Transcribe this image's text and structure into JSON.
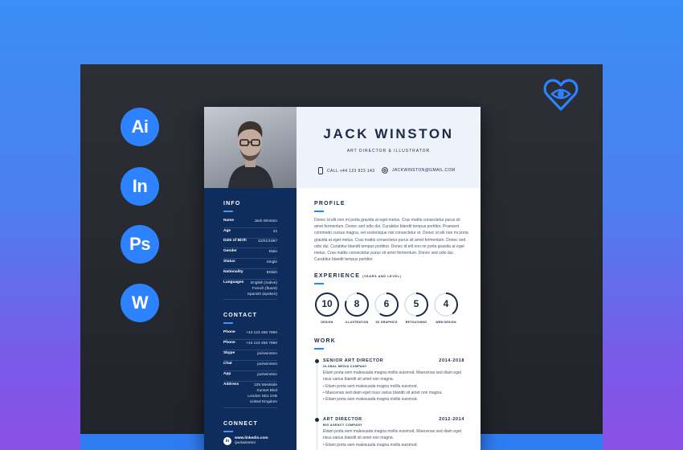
{
  "app_badges": [
    {
      "label": "Ai",
      "icon": "illustrator-icon"
    },
    {
      "label": "In",
      "icon": "indesign-icon"
    },
    {
      "label": "Ps",
      "icon": "photoshop-icon"
    },
    {
      "label": "W",
      "icon": "word-icon"
    }
  ],
  "logo": {
    "icon": "heart-eye-logo-icon",
    "color": "#2d82ff"
  },
  "colors": {
    "accent": "#2d82ff",
    "sidebar": "#0f2d5c",
    "header_bg": "#eef3fb",
    "ink": "#1b2a45"
  },
  "resume": {
    "name": "JACK WINSTON",
    "title": "ART DIRECTOR & ILLUSTRATOR",
    "phone": "CALL +44 123 823 143",
    "email": "JACKWINSTON@GMAIL.COM",
    "info": {
      "heading": "INFO",
      "rows": [
        {
          "key": "Name",
          "value": "Jack Winston"
        },
        {
          "key": "Age",
          "value": "32"
        },
        {
          "key": "Date of Birth",
          "value": "12/01/1987"
        },
        {
          "key": "Gender",
          "value": "Male"
        },
        {
          "key": "Status",
          "value": "Single"
        },
        {
          "key": "Nationality",
          "value": "British"
        },
        {
          "key": "Languages",
          "value": "English (native)\nFrench (fluent)\nSpanish (spoken)"
        }
      ]
    },
    "contact": {
      "heading": "CONTACT",
      "rows": [
        {
          "key": "Phone",
          "value": "+44 123 456 7890"
        },
        {
          "key": "Phone",
          "value": "+44 123 456 7890"
        },
        {
          "key": "Skype",
          "value": "jackwinston"
        },
        {
          "key": "Chat",
          "value": "jackwinston"
        },
        {
          "key": "App",
          "value": "jackwinston"
        },
        {
          "key": "Address",
          "value": "125 Westside\nSunset Blvd\nLondon SE1 2AB\nUnited Kingdom"
        }
      ]
    },
    "connect": {
      "heading": "CONNECT",
      "items": [
        {
          "icon": "linkedin-icon",
          "label": "www.linkedin.com",
          "handle": "/jackwinston"
        }
      ]
    },
    "profile": {
      "heading": "PROFILE",
      "text": "Donec id elit non mi porta gravida at eget metus. Cras mattis consectetur purus sit amet fermentum. Donec sed odio dui. Curabitur blandit tempus porttitor. Praesent commodo cursus magna, vel scelerisque nisl consectetur et. Donec id elit non mi porta gravida at eget metus. Cras mattis consectetur purus sit amet fermentum. Donec sed odio dui. Curabitur blandit tempus porttitor. Donec id elit non mi porta gravida at eget metus. Cras mattis consectetur purus sit amet fermentum. Donec sed odio dui. Curabitur blandit tempus porttitor."
    },
    "experience": {
      "heading": "EXPERIENCE",
      "subheading": "(YEARS AND LEVEL)",
      "skills": [
        {
          "value": "10",
          "label": "DESIGN",
          "level": 1.0
        },
        {
          "value": "8",
          "label": "ILLUSTRATION",
          "level": 0.8
        },
        {
          "value": "6",
          "label": "3D GRAPHICS",
          "level": 0.6
        },
        {
          "value": "5",
          "label": "RETOUCHING",
          "level": 0.5
        },
        {
          "value": "4",
          "label": "WEB DESIGN",
          "level": 0.4
        }
      ]
    },
    "work": {
      "heading": "WORK",
      "jobs": [
        {
          "title": "SENIOR ART DIRECTOR",
          "years": "2014-2018",
          "company": "GLOBAL MEDIA COMPANY",
          "desc": "Etiam porta sem malesuada magna mollis euismod. Maecenas sed diam eget risus varius blandit sit amet non magna.",
          "bullets": [
            "Etiam porta sem malesuada magna mollis euismod.",
            "Maecenas sed diam eget risus varius blandit sit amet non magna.",
            "Etiam porta sem malesuada magna mollis euismod."
          ]
        },
        {
          "title": "ART DIRECTOR",
          "years": "2012-2014",
          "company": "BIG AGENCY COMPANY",
          "desc": "Etiam porta sem malesuada magna mollis euismod. Maecenas sed diam eget risus varius blandit sit amet non magna.",
          "bullets": [
            "Etiam porta sem malesuada magna mollis euismod."
          ]
        }
      ]
    }
  }
}
